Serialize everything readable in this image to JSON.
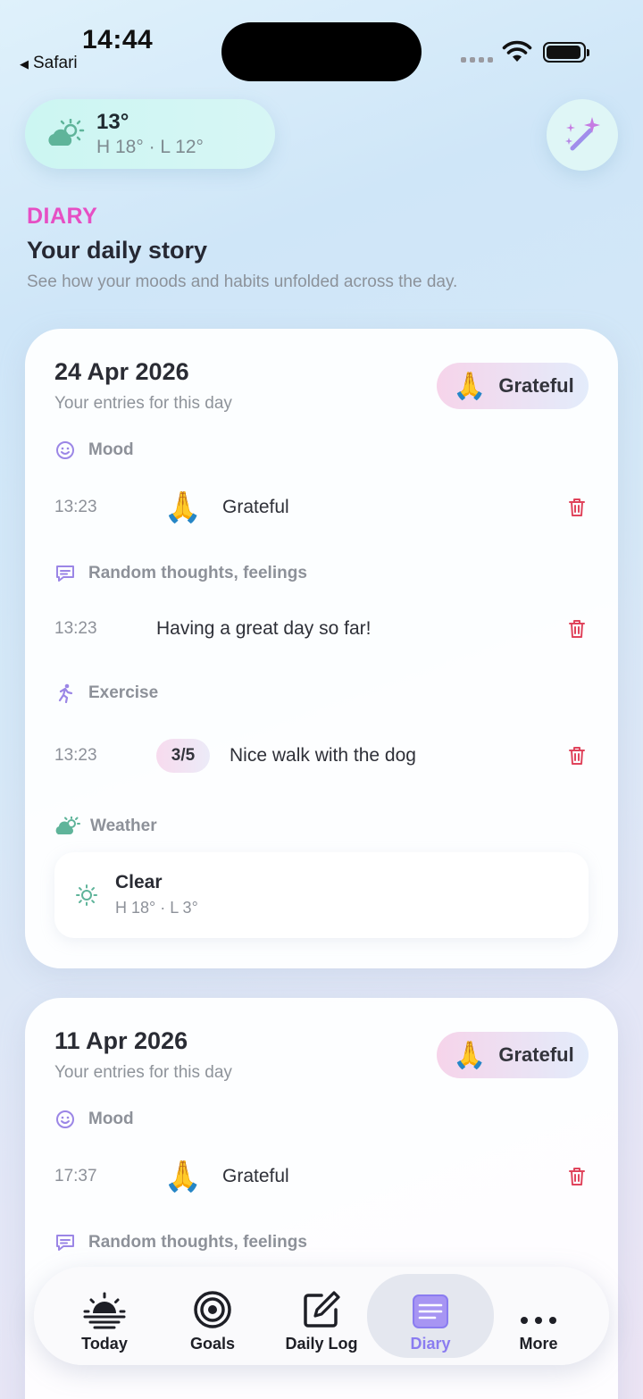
{
  "status_bar": {
    "time": "14:44",
    "back_app": "Safari"
  },
  "weather": {
    "temp": "13°",
    "high_low": "H 18° · L 12°"
  },
  "header": {
    "eyebrow": "DIARY",
    "title": "Your daily story",
    "subtitle": "See how your moods and habits unfolded across the day."
  },
  "days": [
    {
      "date": "24 Apr 2026",
      "date_sub": "Your entries for this day",
      "mood_badge": {
        "emoji": "🙏",
        "label": "Grateful"
      },
      "mood": {
        "heading": "Mood",
        "time": "13:23",
        "emoji": "🙏",
        "label": "Grateful"
      },
      "thoughts": {
        "heading": "Random thoughts, feelings",
        "time": "13:23",
        "text": "Having a great day so far!"
      },
      "exercise": {
        "heading": "Exercise",
        "time": "13:23",
        "score": "3/5",
        "text": "Nice walk with the dog"
      },
      "weather": {
        "heading": "Weather",
        "condition": "Clear",
        "high_low": "H 18° · L 3°"
      }
    },
    {
      "date": "11 Apr 2026",
      "date_sub": "Your entries for this day",
      "mood_badge": {
        "emoji": "🙏",
        "label": "Grateful"
      },
      "mood": {
        "heading": "Mood",
        "time": "17:37",
        "emoji": "🙏",
        "label": "Grateful"
      },
      "thoughts": {
        "heading": "Random thoughts, feelings"
      }
    }
  ],
  "tabs": [
    {
      "label": "Today",
      "icon": "sunrise-icon"
    },
    {
      "label": "Goals",
      "icon": "target-icon"
    },
    {
      "label": "Daily Log",
      "icon": "edit-icon"
    },
    {
      "label": "Diary",
      "icon": "diary-icon",
      "active": true
    },
    {
      "label": "More",
      "icon": "more-icon"
    }
  ],
  "colors": {
    "accent": "#e64fc4",
    "active_tab": "#8a7cf0",
    "delete": "#e0445c",
    "icon_purple": "#9b86e6"
  }
}
